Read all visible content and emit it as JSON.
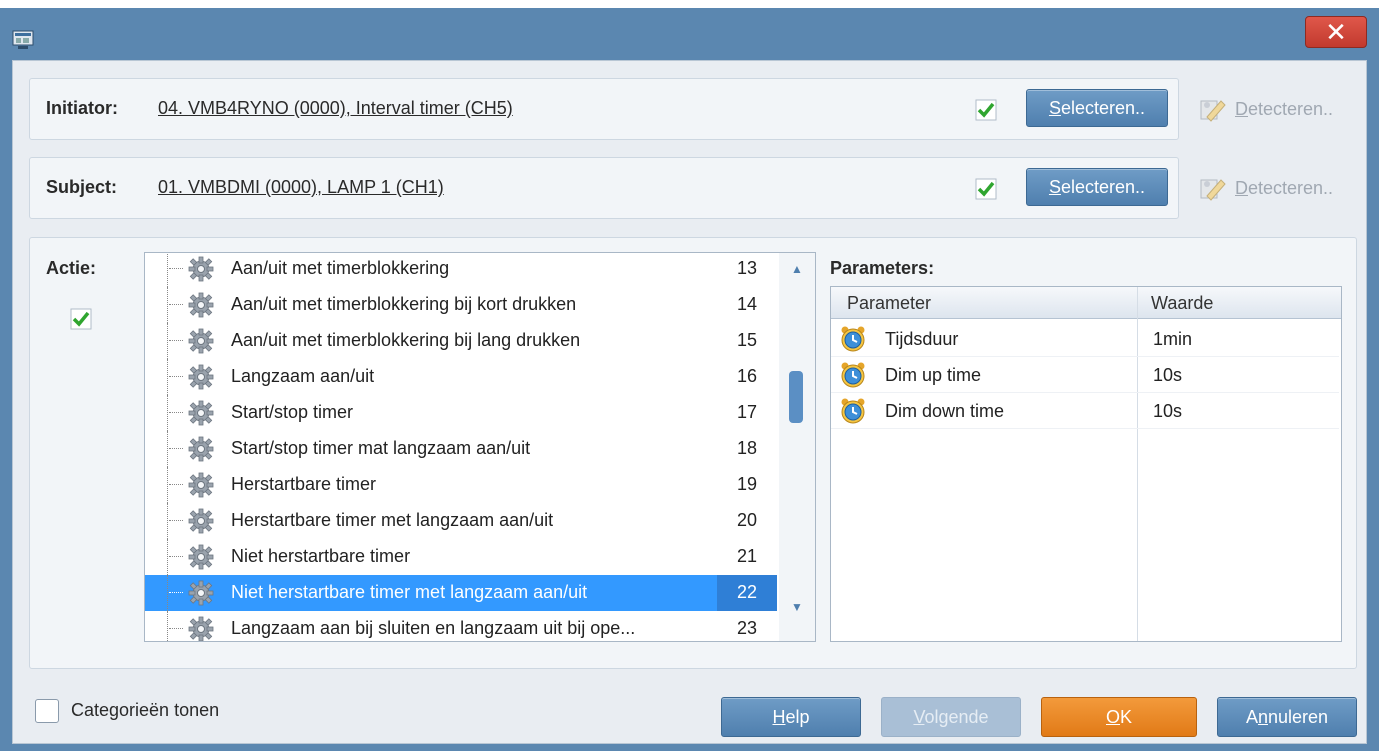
{
  "window": {
    "close_label": "✕"
  },
  "initiator": {
    "label": "Initiator:",
    "value": "04. VMB4RYNO (0000), Interval timer (CH5)",
    "select_label_u": "S",
    "select_label_rest": "electeren..",
    "detect_label_u": "D",
    "detect_label_rest": "etecteren.."
  },
  "subject": {
    "label": "Subject:",
    "value": "01. VMBDMI (0000), LAMP 1 (CH1)",
    "select_label_u": "S",
    "select_label_rest": "electeren..",
    "detect_label_u": "D",
    "detect_label_rest": "etecteren.."
  },
  "actie": {
    "label": "Actie:",
    "items": [
      {
        "label": "Aan/uit met timerblokkering",
        "num": "13"
      },
      {
        "label": "Aan/uit met timerblokkering bij kort drukken",
        "num": "14"
      },
      {
        "label": "Aan/uit met timerblokkering bij lang drukken",
        "num": "15"
      },
      {
        "label": "Langzaam aan/uit",
        "num": "16"
      },
      {
        "label": "Start/stop timer",
        "num": "17"
      },
      {
        "label": "Start/stop timer mat langzaam aan/uit",
        "num": "18"
      },
      {
        "label": "Herstartbare timer",
        "num": "19"
      },
      {
        "label": "Herstartbare timer met langzaam aan/uit",
        "num": "20"
      },
      {
        "label": "Niet herstartbare timer",
        "num": "21"
      },
      {
        "label": "Niet herstartbare timer met langzaam aan/uit",
        "num": "22"
      },
      {
        "label": "Langzaam aan bij sluiten en langzaam uit bij ope...",
        "num": "23"
      }
    ],
    "selected_index": 9
  },
  "parameters": {
    "title": "Parameters:",
    "col_parameter": "Parameter",
    "col_value": "Waarde",
    "rows": [
      {
        "name": "Tijdsduur",
        "value": "1min"
      },
      {
        "name": "Dim up time",
        "value": "10s"
      },
      {
        "name": "Dim down time",
        "value": "10s"
      }
    ]
  },
  "footer": {
    "show_categories": "Categorieën tonen",
    "help_u": "H",
    "help_rest": "elp",
    "next_u": "V",
    "next_rest": "olgende",
    "ok_u": "O",
    "ok_rest": "K",
    "cancel_pre": "A",
    "cancel_u": "n",
    "cancel_rest": "nuleren"
  },
  "colors": {
    "title_bar": "#5b87b0",
    "selection": "#3399ff",
    "ok_button": "#e17a17",
    "check_green": "#2fa52f"
  }
}
